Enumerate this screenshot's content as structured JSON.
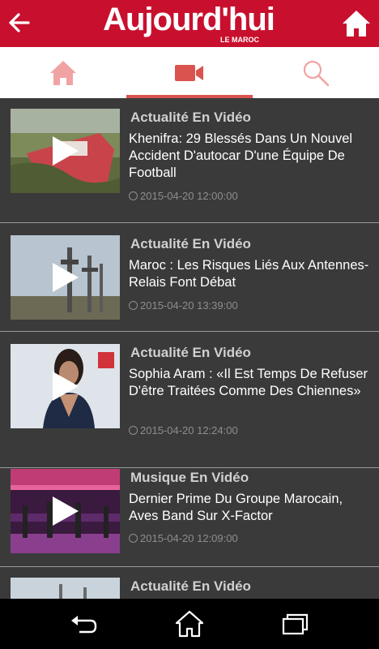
{
  "header": {
    "logo_title": "Aujourd'hui",
    "logo_subtitle": "LE MAROC",
    "back_icon": "back-arrow-icon",
    "home_icon": "home-icon",
    "color": "#c8102e"
  },
  "tabs": [
    {
      "icon": "home-icon",
      "active": false
    },
    {
      "icon": "video-camera-icon",
      "active": true
    },
    {
      "icon": "search-icon",
      "active": false
    }
  ],
  "accent_color": "#d9534f",
  "articles": [
    {
      "category": "Actualité En Vidéo",
      "title": "Khenifra: 29 Blessés Dans Un Nouvel Accident D'autocar D'une Équipe De Football",
      "date": "2015-04-20 12:00:00"
    },
    {
      "category": "Actualité En Vidéo",
      "title": "Maroc : Les Risques Liés Aux Antennes-Relais Font Débat",
      "date": "2015-04-20 13:39:00"
    },
    {
      "category": "Actualité En Vidéo",
      "title": "Sophia Aram : «Il Est Temps De Refuser D'être Traitées Comme Des Chiennes»",
      "date": "2015-04-20 12:24:00"
    },
    {
      "category": "Musique En Vidéo",
      "title": "Dernier Prime Du Groupe Marocain, Aves Band Sur X-Factor",
      "date": "2015-04-20 12:09:00"
    },
    {
      "category": "Actualité En Vidéo",
      "title": "",
      "date": ""
    }
  ],
  "navbar": {
    "back_icon": "nav-back-icon",
    "home_icon": "nav-home-icon",
    "recents_icon": "nav-recents-icon"
  }
}
